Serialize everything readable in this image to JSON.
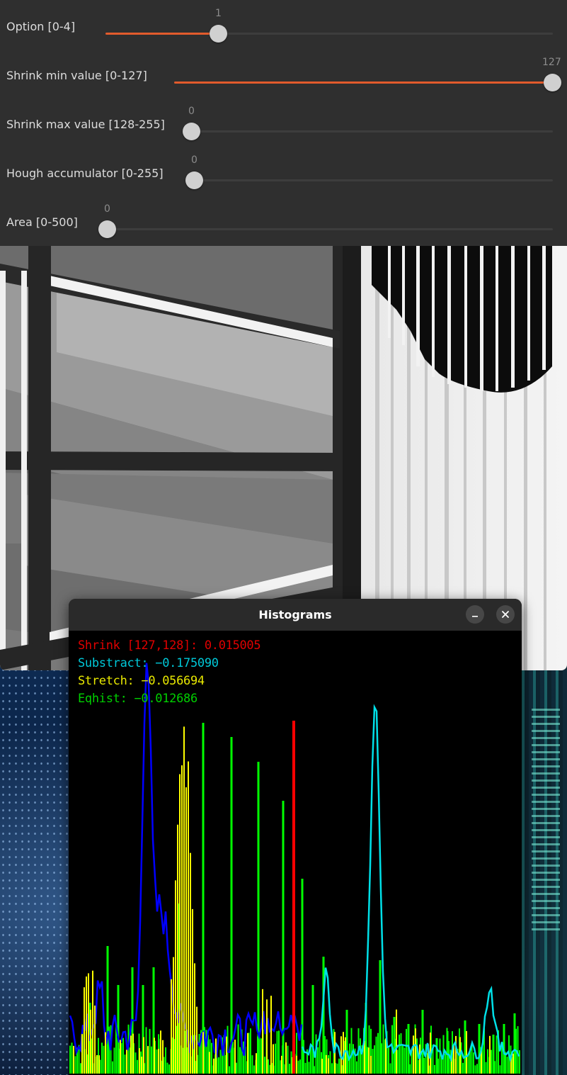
{
  "controls": {
    "sliders": [
      {
        "label": "Option [0-4]",
        "value": "1",
        "fraction": 0.25
      },
      {
        "label": "Shrink min value [0-127]",
        "value": "127",
        "fraction": 1.0
      },
      {
        "label": "Shrink max value [128-255]",
        "value": "0",
        "fraction": 0.0
      },
      {
        "label": "Hough accumulator [0-255]",
        "value": "0",
        "fraction": 0.0
      },
      {
        "label": "Area [0-500]",
        "value": "0",
        "fraction": 0.0
      }
    ]
  },
  "histogram_window": {
    "title": "Histograms",
    "minimize_icon": "minimize-icon",
    "close_icon": "close-icon",
    "stats": [
      {
        "text": "Shrink [127,128]: 0.015005",
        "color": "#e00000"
      },
      {
        "text": "Substract: −0.175090",
        "color": "#00c8d8"
      },
      {
        "text": "Stretch: −0.056694",
        "color": "#e8e800"
      },
      {
        "text": "Eqhist: −0.012686",
        "color": "#00d000"
      }
    ]
  },
  "colors": {
    "slider_accent": "#e25b2c",
    "shrink": "#ff0000",
    "substract": "#00e0e8",
    "stretch": "#ffff00",
    "eqhist": "#00ff00",
    "original": "#0000ff"
  }
}
